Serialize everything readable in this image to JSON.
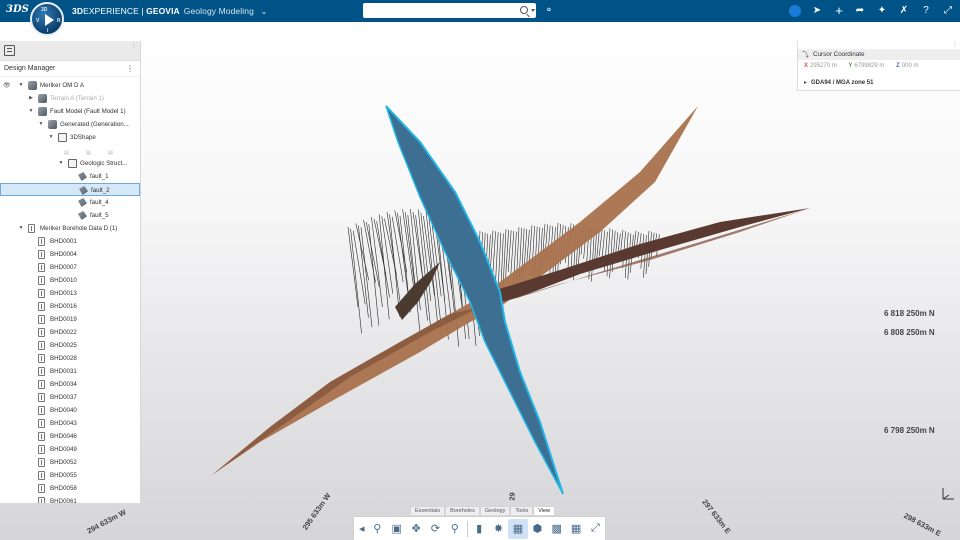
{
  "topbar": {
    "logo": "3DS",
    "compass_labels": {
      "3d": "3D",
      "v": "V",
      "r": "R",
      "i": "i"
    },
    "brand_prefix": "3D",
    "brand_main": "EXPERIENCE | ",
    "brand_geovia": "GEOVIA",
    "app_name": "Geology Modeling",
    "search_placeholder": "",
    "icons": [
      "tag-icon",
      "user-avatar",
      "share-icon",
      "plus-icon",
      "forward-icon",
      "network-icon",
      "tools-icon",
      "help-icon",
      "collapse-icon"
    ]
  },
  "design_manager": {
    "title": "Design Manager",
    "tree": [
      {
        "label": "Meriker OM D A",
        "level": 0,
        "icon": "part",
        "caret": "down"
      },
      {
        "label": "Terrain A (Terrain 1)",
        "level": 1,
        "icon": "part",
        "caret": "right",
        "dim": true
      },
      {
        "label": "Fault Model (Fault Model 1)",
        "level": 1,
        "icon": "part",
        "caret": "down"
      },
      {
        "label": "Generated (Generation...",
        "level": 2,
        "icon": "part",
        "caret": "down"
      },
      {
        "label": "3DShape",
        "level": 3,
        "icon": "shape",
        "caret": "down"
      },
      {
        "label": "",
        "level": 4,
        "icon": "mini",
        "caret": ""
      },
      {
        "label": "Geologic Struct...",
        "level": 4,
        "icon": "shape",
        "caret": "down"
      },
      {
        "label": "fault_1",
        "level": 5,
        "icon": "fault",
        "caret": ""
      },
      {
        "label": "fault_2",
        "level": 5,
        "icon": "fault",
        "caret": "",
        "selected": true
      },
      {
        "label": "fault_4",
        "level": 5,
        "icon": "fault",
        "caret": ""
      },
      {
        "label": "fault_5",
        "level": 5,
        "icon": "fault",
        "caret": ""
      },
      {
        "label": "Meriker Borehole Data D (1)",
        "level": 0,
        "icon": "bh",
        "caret": "down"
      },
      {
        "label": "BHD0001",
        "level": 1,
        "icon": "bh",
        "caret": ""
      },
      {
        "label": "BHD0004",
        "level": 1,
        "icon": "bh",
        "caret": ""
      },
      {
        "label": "BHD0007",
        "level": 1,
        "icon": "bh",
        "caret": ""
      },
      {
        "label": "BHD0010",
        "level": 1,
        "icon": "bh",
        "caret": ""
      },
      {
        "label": "BHD0013",
        "level": 1,
        "icon": "bh",
        "caret": ""
      },
      {
        "label": "BHD0016",
        "level": 1,
        "icon": "bh",
        "caret": ""
      },
      {
        "label": "BHD0019",
        "level": 1,
        "icon": "bh",
        "caret": ""
      },
      {
        "label": "BHD0022",
        "level": 1,
        "icon": "bh",
        "caret": ""
      },
      {
        "label": "BHD0025",
        "level": 1,
        "icon": "bh",
        "caret": ""
      },
      {
        "label": "BHD0028",
        "level": 1,
        "icon": "bh",
        "caret": ""
      },
      {
        "label": "BHD0031",
        "level": 1,
        "icon": "bh",
        "caret": ""
      },
      {
        "label": "BHD0034",
        "level": 1,
        "icon": "bh",
        "caret": ""
      },
      {
        "label": "BHD0037",
        "level": 1,
        "icon": "bh",
        "caret": ""
      },
      {
        "label": "BHD0040",
        "level": 1,
        "icon": "bh",
        "caret": ""
      },
      {
        "label": "BHD0043",
        "level": 1,
        "icon": "bh",
        "caret": ""
      },
      {
        "label": "BHD0046",
        "level": 1,
        "icon": "bh",
        "caret": ""
      },
      {
        "label": "BHD0049",
        "level": 1,
        "icon": "bh",
        "caret": ""
      },
      {
        "label": "BHD0052",
        "level": 1,
        "icon": "bh",
        "caret": ""
      },
      {
        "label": "BHD0055",
        "level": 1,
        "icon": "bh",
        "caret": ""
      },
      {
        "label": "BHD0058",
        "level": 1,
        "icon": "bh",
        "caret": ""
      },
      {
        "label": "BHD0061",
        "level": 1,
        "icon": "bh",
        "caret": ""
      }
    ]
  },
  "cursor_coordinate": {
    "title": "Cursor Coordinate",
    "x_label": "X",
    "x_value": "295270 m",
    "y_label": "Y",
    "y_value": "6799829 m",
    "z_label": "Z",
    "z_value": "000 m",
    "crs": "GDA94 / MGA zone 51"
  },
  "scene": {
    "north_labels": [
      "6 818 250m N",
      "6 808 250m N",
      "6 798 250m N"
    ],
    "east_labels": [
      "294 633m W",
      "295 633m W",
      "29",
      "297 633m E",
      "298 633m E"
    ],
    "colors": {
      "fault_blue": "#3d6f93",
      "fault_highlight": "#21b5e6",
      "fault_brown": "#a8714d",
      "fault_dark": "#5a3a30"
    }
  },
  "action_bar": {
    "tabs": [
      "Essentials",
      "Boreholes",
      "Geology",
      "Tools",
      "View"
    ],
    "active_tab": "View",
    "tools": [
      "zoom-fit-icon",
      "cube-icon",
      "pan-icon",
      "rotate-icon",
      "zoom-icon",
      "sectioning-icon",
      "render-style-icon",
      "view-mode-icon",
      "box-icon",
      "capture-icon",
      "grid-icon",
      "axis-icon"
    ]
  }
}
